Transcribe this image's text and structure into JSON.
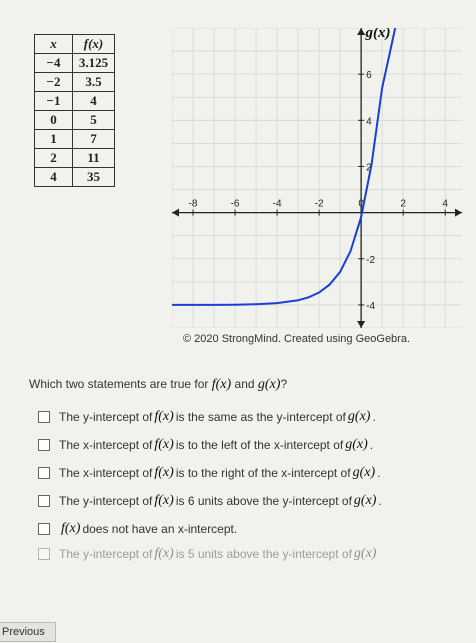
{
  "table": {
    "headers": [
      "x",
      "f(x)"
    ],
    "rows": [
      [
        "−4",
        "3.125"
      ],
      [
        "−2",
        "3.5"
      ],
      [
        "−1",
        "4"
      ],
      [
        "0",
        "5"
      ],
      [
        "1",
        "7"
      ],
      [
        "2",
        "11"
      ],
      [
        "4",
        "35"
      ]
    ]
  },
  "chart_data": {
    "type": "line",
    "series": [
      {
        "name": "g(x)",
        "x": [
          -9,
          -7,
          -6,
          -5,
          -4,
          -3,
          -2.5,
          -2,
          -1.5,
          -1,
          -0.5,
          0,
          0.5,
          1,
          1.5,
          2
        ],
        "y": [
          -4,
          -4,
          -3.99,
          -3.97,
          -3.92,
          -3.8,
          -3.67,
          -3.46,
          -3.12,
          -2.57,
          -1.66,
          -0.2,
          2.1,
          5.4,
          7.5,
          9.6
        ]
      }
    ],
    "xlim": [
      -9,
      4.8
    ],
    "ylim": [
      -5,
      8
    ],
    "x_ticks": [
      "-8",
      "-6",
      "-4",
      "-2",
      "0",
      "2",
      "4"
    ],
    "y_ticks": [
      "6",
      "4",
      "2",
      "-2",
      "-4"
    ],
    "curve_label": "g(x)",
    "grid": true,
    "color": "#1a3fd6"
  },
  "credit": "© 2020 StrongMind. Created using GeoGebra.",
  "question": {
    "prefix": "Which two statements are true for",
    "f": "f(x)",
    "and": "and",
    "g": "g(x)",
    "suffix": "?"
  },
  "options": [
    {
      "parts": [
        "The y-intercept of",
        "f(x)",
        "is the same as the y-intercept of",
        "g(x)",
        "."
      ]
    },
    {
      "parts": [
        "The x-intercept of",
        "f(x)",
        "is to the left of the x-intercept of",
        "g(x)",
        "."
      ]
    },
    {
      "parts": [
        "The x-intercept of",
        "f(x)",
        "is to the right of the x-intercept of",
        "g(x)",
        "."
      ]
    },
    {
      "parts": [
        "The y-intercept of",
        "f(x)",
        "is 6 units above the y-intercept of",
        "g(x)",
        "."
      ]
    },
    {
      "parts": [
        "",
        "f(x)",
        "does not have an x-intercept.",
        "",
        ""
      ]
    },
    {
      "parts": [
        "The y-intercept of",
        "f(x)",
        "is 5 units above the y-intercept of",
        "g(x)",
        ""
      ]
    }
  ],
  "nav": {
    "previous": "Previous"
  }
}
